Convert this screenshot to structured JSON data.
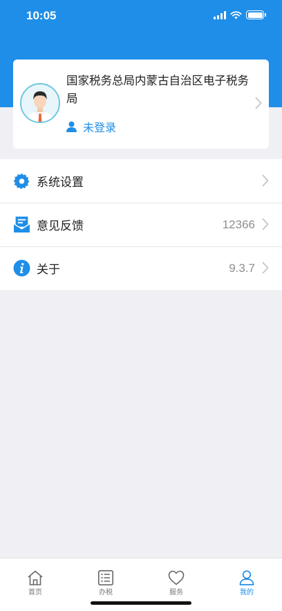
{
  "status_bar": {
    "time": "10:05"
  },
  "profile": {
    "org_name": "国家税务总局内蒙古自治区电子税务局",
    "login_status": "未登录"
  },
  "menu": [
    {
      "label": "系统设置",
      "value": "",
      "icon": "gear-icon"
    },
    {
      "label": "意见反馈",
      "value": "12366",
      "icon": "feedback-icon"
    },
    {
      "label": "关于",
      "value": "9.3.7",
      "icon": "info-icon"
    }
  ],
  "tabs": [
    {
      "label": "首页",
      "icon": "home-icon",
      "active": false
    },
    {
      "label": "办税",
      "icon": "list-icon",
      "active": false
    },
    {
      "label": "服务",
      "icon": "heart-icon",
      "active": false
    },
    {
      "label": "我的",
      "icon": "person-icon",
      "active": true
    }
  ],
  "colors": {
    "primary": "#1f8ee8",
    "background": "#efeff4"
  }
}
